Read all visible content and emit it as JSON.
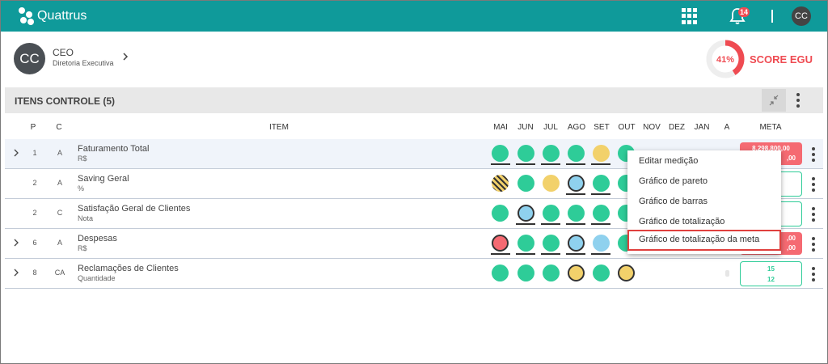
{
  "topbar": {
    "brand": "Quattrus",
    "notification_count": "14",
    "user_initials": "CC",
    "icons": [
      "apps-grid-icon",
      "bell-icon"
    ]
  },
  "user": {
    "initials": "CC",
    "name": "CEO",
    "department": "Diretoria Executiva"
  },
  "score": {
    "percent": "41%",
    "value": 0.41,
    "label": "SCORE EGU",
    "color": "#ef4b52"
  },
  "section": {
    "title": "ITENS CONTROLE (5)"
  },
  "table": {
    "headers": {
      "p": "P",
      "c": "C",
      "item": "ITEM",
      "months": [
        "MAI",
        "JUN",
        "JUL",
        "AGO",
        "SET",
        "OUT",
        "NOV",
        "DEZ",
        "JAN",
        "A"
      ],
      "meta": "META"
    },
    "rows": [
      {
        "p": "1",
        "c": "A",
        "name": "Faturamento Total",
        "unit": "R$",
        "meta": [
          "8.298.800,00",
          ",00"
        ]
      },
      {
        "p": "2",
        "c": "A",
        "name": "Saving Geral",
        "unit": "%"
      },
      {
        "p": "2",
        "c": "C",
        "name": "Satisfação Geral de Clientes",
        "unit": "Nota"
      },
      {
        "p": "6",
        "c": "A",
        "name": "Despesas",
        "unit": "R$",
        "meta": [
          ",00",
          ",00"
        ]
      },
      {
        "p": "8",
        "c": "CA",
        "name": "Reclamações de Clientes",
        "unit": "Quantidade",
        "meta": [
          "15",
          "12"
        ]
      }
    ]
  },
  "context_menu": {
    "items": [
      "Editar medição",
      "Gráfico de pareto",
      "Gráfico de barras",
      "Gráfico de totalização",
      "Gráfico de totalização da meta"
    ],
    "selected_index": 4
  },
  "colors": {
    "topbar": "#0f9a9a",
    "green": "#2ecc98",
    "yellow": "#f2d16b",
    "blue": "#8fd1ee",
    "red": "#f56a72"
  }
}
